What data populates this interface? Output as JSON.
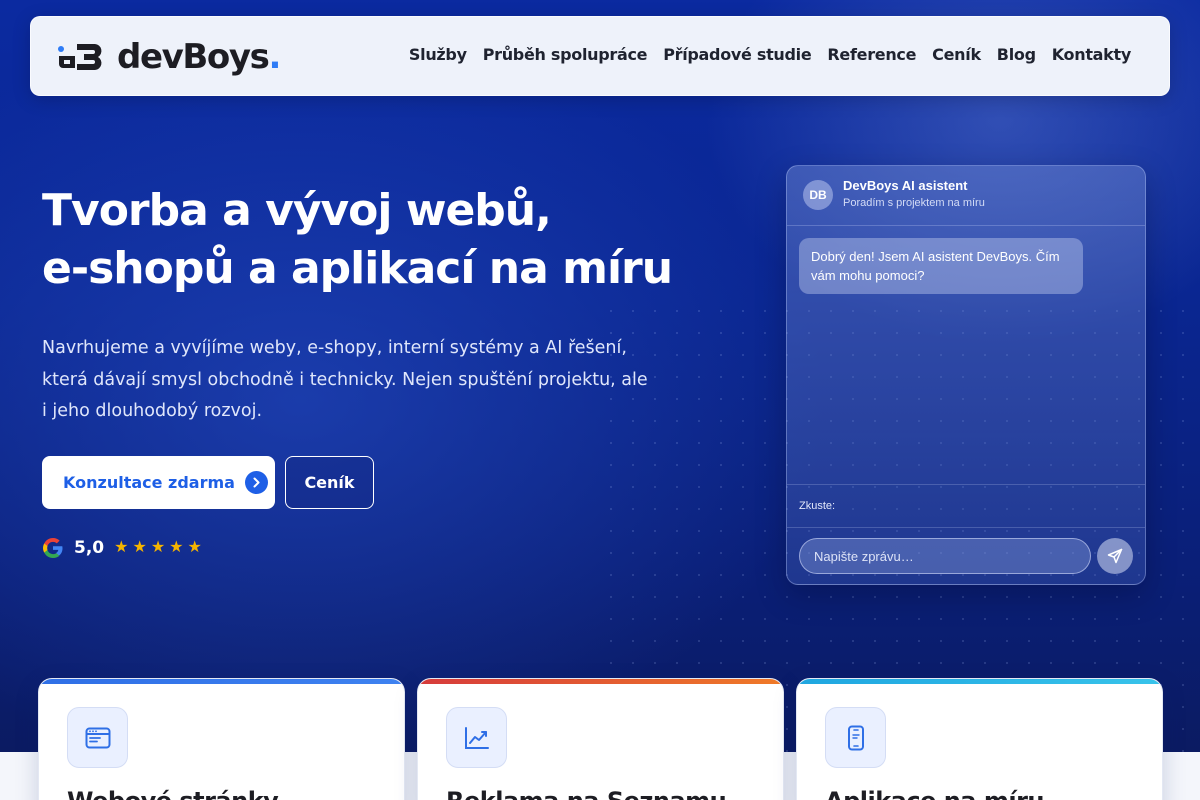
{
  "brand": {
    "name": "devBoys",
    "dot": ".",
    "accent": "#2e7cf6"
  },
  "nav": {
    "items": [
      {
        "label": "Služby"
      },
      {
        "label": "Průběh spolupráce"
      },
      {
        "label": "Případové studie"
      },
      {
        "label": "Reference"
      },
      {
        "label": "Ceník"
      },
      {
        "label": "Blog"
      },
      {
        "label": "Kontakty"
      }
    ]
  },
  "hero": {
    "title_line1": "Tvorba a vývoj webů,",
    "title_line2": "e-shopů a aplikací na míru",
    "subtitle": "Navrhujeme a vyvíjíme weby, e-shopy, interní systémy a AI řešení, která dávají smysl obchodně i technicky. Nejen spuštění projektu, ale i jeho dlouhodobý rozvoj.",
    "cta_primary": "Konzultace zdarma",
    "cta_secondary": "Ceník",
    "rating_value": "5,0",
    "rating_stars": 5
  },
  "chat": {
    "avatar": "DB",
    "name": "DevBoys AI asistent",
    "tagline": "Poradím s projektem na míru",
    "greeting": "Dobrý den! Jsem AI asistent DevBoys. Čím vám mohu pomoci?",
    "suggest_label": "Zkuste:",
    "input_placeholder": "Napište zprávu…"
  },
  "cards": [
    {
      "title": "Webové stránky",
      "icon": "browser-icon",
      "accent": "#2f6fe6"
    },
    {
      "title": "Reklama na Seznamu",
      "icon": "chart-icon",
      "accent": "#e0452f"
    },
    {
      "title": "Aplikace na míru",
      "icon": "phone-icon",
      "accent": "#14a7e0"
    }
  ]
}
